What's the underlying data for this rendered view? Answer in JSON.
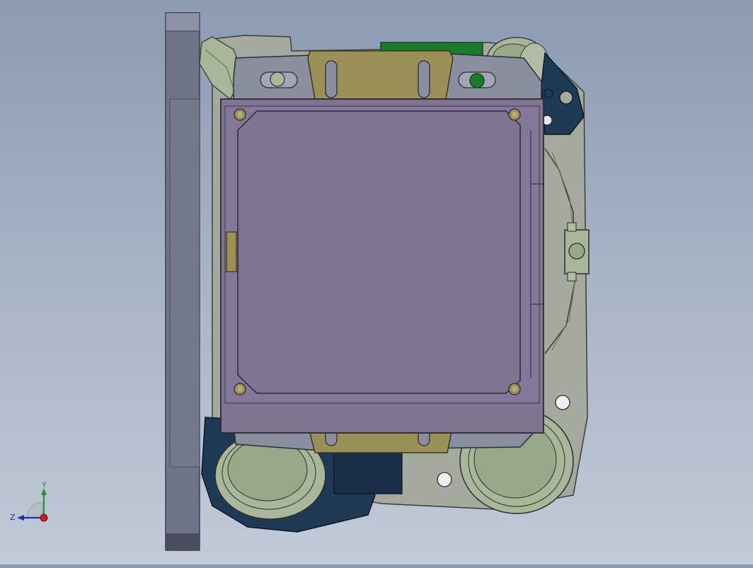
{
  "viewport": {
    "background_top": "#8c9bb2",
    "background_bottom": "#c2cad8"
  },
  "model": {
    "colors": {
      "purple_plate": "#7f7591",
      "purple_plate_border": "#5b5070",
      "gold_bracket": "#9a9058",
      "gray_block": "#6f7488",
      "clamp_gray": "#8a8fa0",
      "dark_blue": "#1e3a55",
      "pale_green": "#a9b69a",
      "body_gray": "#a5aa9e",
      "green_board": "#1d7a2a",
      "light_green_circle": "#98a98a"
    }
  },
  "triad": {
    "x_label": "",
    "y_label": "Y",
    "z_label": "Z",
    "icons": [
      "y-axis-arrow-icon",
      "z-axis-arrow-icon",
      "origin-point-icon"
    ]
  }
}
